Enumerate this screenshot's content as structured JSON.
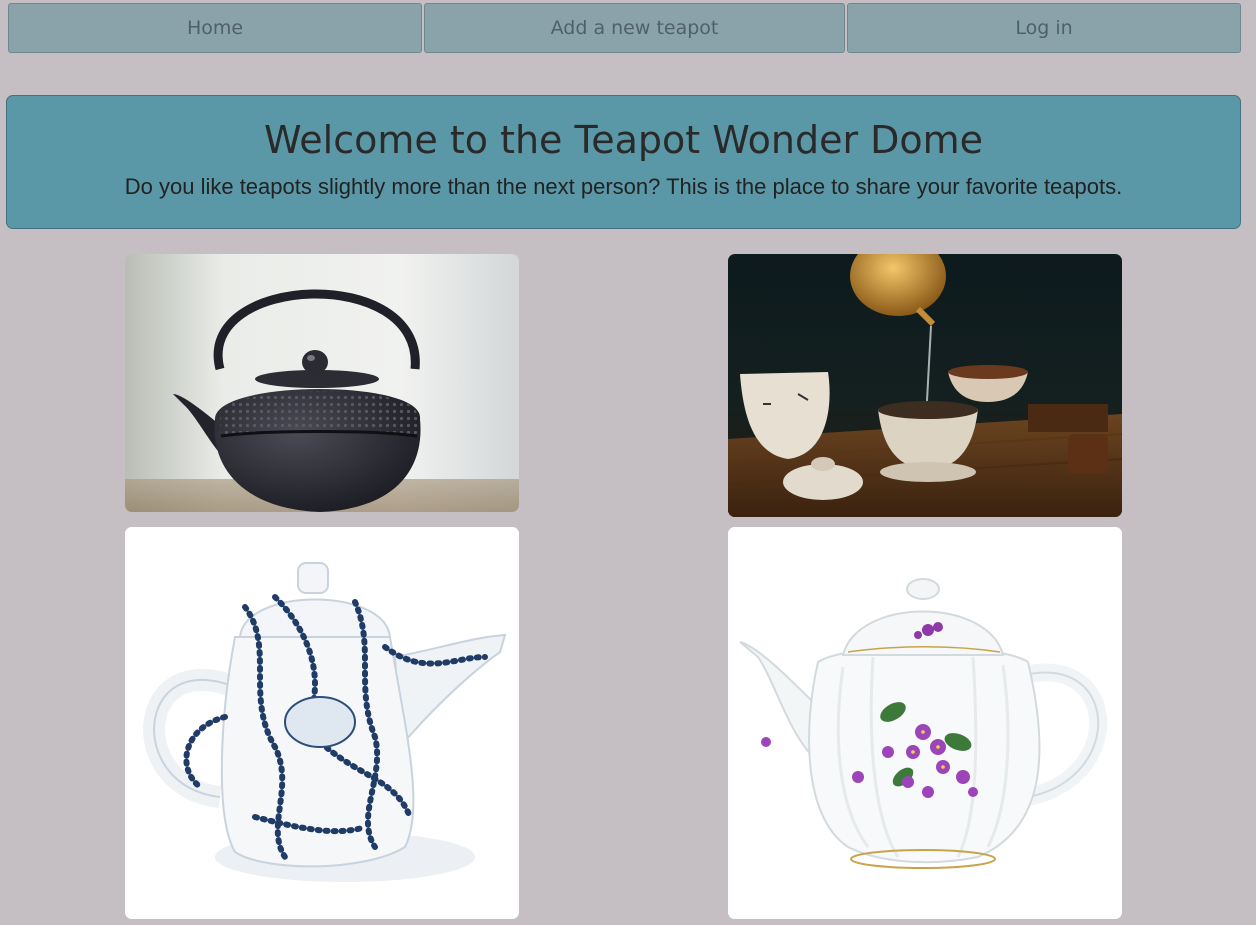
{
  "nav": {
    "home_label": "Home",
    "add_label": "Add a new teapot",
    "login_label": "Log in"
  },
  "hero": {
    "title": "Welcome to the Teapot Wonder Dome",
    "subtitle": "Do you like teapots slightly more than the next person? This is the place to share your favorite teapots."
  },
  "gallery": {
    "items": [
      {
        "subject": "cast-iron-teapot"
      },
      {
        "subject": "pouring-tea-ceremony"
      },
      {
        "subject": "octopus-porcelain-teapot"
      },
      {
        "subject": "violet-floral-teapot"
      }
    ]
  },
  "colors": {
    "page_background": "#c5bec3",
    "nav_button": "#8aa3aa",
    "hero_background": "#5b98a7"
  }
}
